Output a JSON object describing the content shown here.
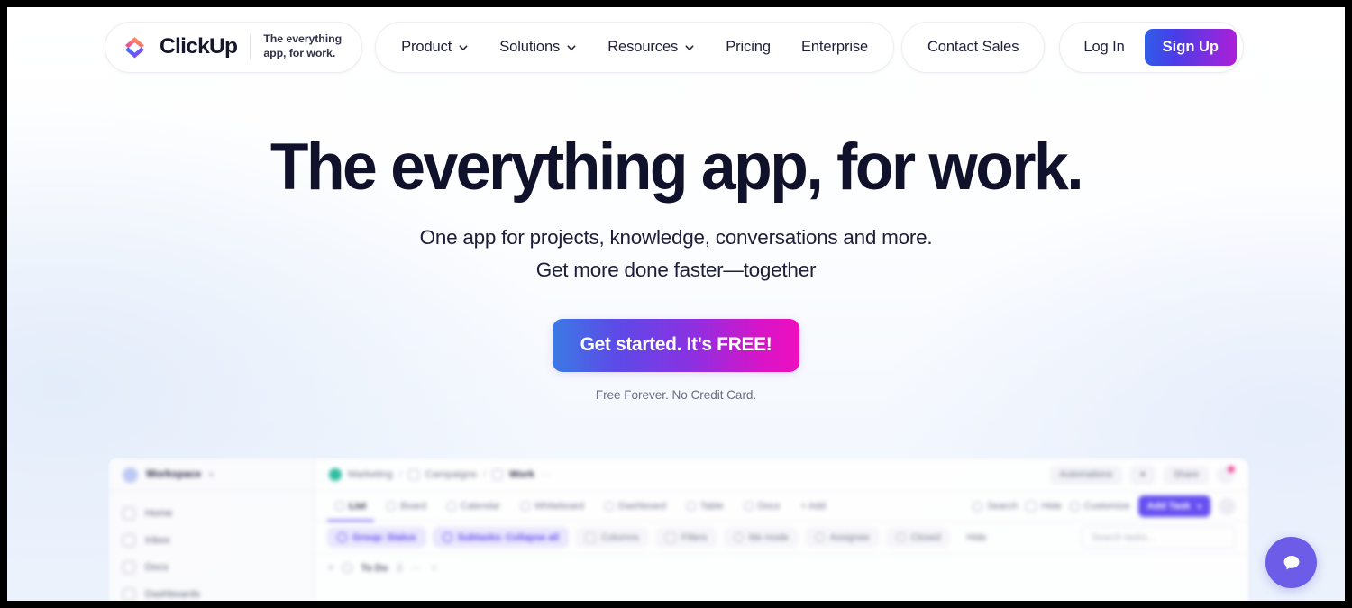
{
  "brand": {
    "name": "ClickUp",
    "tagline_line1": "The everything",
    "tagline_line2": "app, for work.",
    "logo_icon": "clickup-chevron-logo",
    "accent_purple": "#5b44f0",
    "gradient_blue": "#2f5fe8",
    "gradient_magenta": "#ef0fbe"
  },
  "nav": {
    "items": [
      {
        "label": "Product",
        "has_caret": true,
        "icon": "chevron-down-icon"
      },
      {
        "label": "Solutions",
        "has_caret": true,
        "icon": "chevron-down-icon"
      },
      {
        "label": "Resources",
        "has_caret": true,
        "icon": "chevron-down-icon"
      },
      {
        "label": "Pricing",
        "has_caret": false,
        "icon": ""
      },
      {
        "label": "Enterprise",
        "has_caret": false,
        "icon": ""
      }
    ],
    "contact_sales": "Contact Sales",
    "log_in": "Log In",
    "sign_up": "Sign Up"
  },
  "hero": {
    "headline": "The everything app, for work.",
    "subline_1": "One app for projects, knowledge, conversations and more.",
    "subline_2": "Get more done faster—together",
    "cta_label": "Get started. It's FREE!",
    "cta_note": "Free Forever. No Credit Card."
  },
  "app_preview": {
    "workspace": {
      "label": "Workspace",
      "caret": "▾",
      "avatar": "workspace-avatar"
    },
    "sidebar_items": [
      {
        "label": "Home",
        "icon": "home-icon"
      },
      {
        "label": "Inbox",
        "icon": "inbox-icon"
      },
      {
        "label": "Docs",
        "icon": "docs-icon"
      },
      {
        "label": "Dashboards",
        "icon": "dashboards-icon"
      }
    ],
    "breadcrumb": {
      "space": "Marketing",
      "folder": "Campaigns",
      "list": "Work",
      "separator": "/",
      "overflow": "⋯"
    },
    "header_actions": {
      "automations": "Automations",
      "automations_caret": "▾",
      "share": "Share",
      "bell": "notification-bell-icon"
    },
    "view_tabs": [
      {
        "label": "List",
        "active": true,
        "icon": "list-view-icon"
      },
      {
        "label": "Board",
        "active": false,
        "icon": "board-view-icon"
      },
      {
        "label": "Calendar",
        "active": false,
        "icon": "calendar-view-icon"
      },
      {
        "label": "Whiteboard",
        "active": false,
        "icon": "whiteboard-view-icon"
      },
      {
        "label": "Dashboard",
        "active": false,
        "icon": "dashboard-view-icon"
      },
      {
        "label": "Table",
        "active": false,
        "icon": "table-view-icon"
      },
      {
        "label": "Docs",
        "active": false,
        "icon": "docs-view-icon"
      }
    ],
    "add_view": "+ Add",
    "toolbar_right": [
      {
        "label": "Search",
        "icon": "search-icon"
      },
      {
        "label": "Hide",
        "icon": "hide-icon"
      },
      {
        "label": "Customize",
        "icon": "customize-icon"
      }
    ],
    "add_task": {
      "label": "Add Task",
      "caret": "▾"
    },
    "filter_chips": [
      {
        "label": "Group: Status",
        "active": true,
        "icon": "group-icon"
      },
      {
        "label": "Subtasks: Collapse all",
        "active": true,
        "icon": "subtasks-icon"
      },
      {
        "label": "Columns",
        "active": false,
        "icon": "columns-icon"
      },
      {
        "label": "Filters",
        "active": false,
        "icon": "filter-icon"
      },
      {
        "label": "Me mode",
        "active": false,
        "icon": "person-icon"
      },
      {
        "label": "Assignee",
        "active": false,
        "icon": "assignee-icon"
      },
      {
        "label": "Closed",
        "active": false,
        "icon": "closed-icon"
      },
      {
        "label": "Hide",
        "active": false,
        "icon": ""
      }
    ],
    "search_tasks_placeholder": "Search tasks...",
    "task_group": {
      "caret": "▾",
      "label": "To Do",
      "count": "2",
      "more": "⋯",
      "add": "+"
    }
  },
  "chat_widget": {
    "icon": "chat-bubble-icon",
    "color": "#6c5ce7"
  }
}
